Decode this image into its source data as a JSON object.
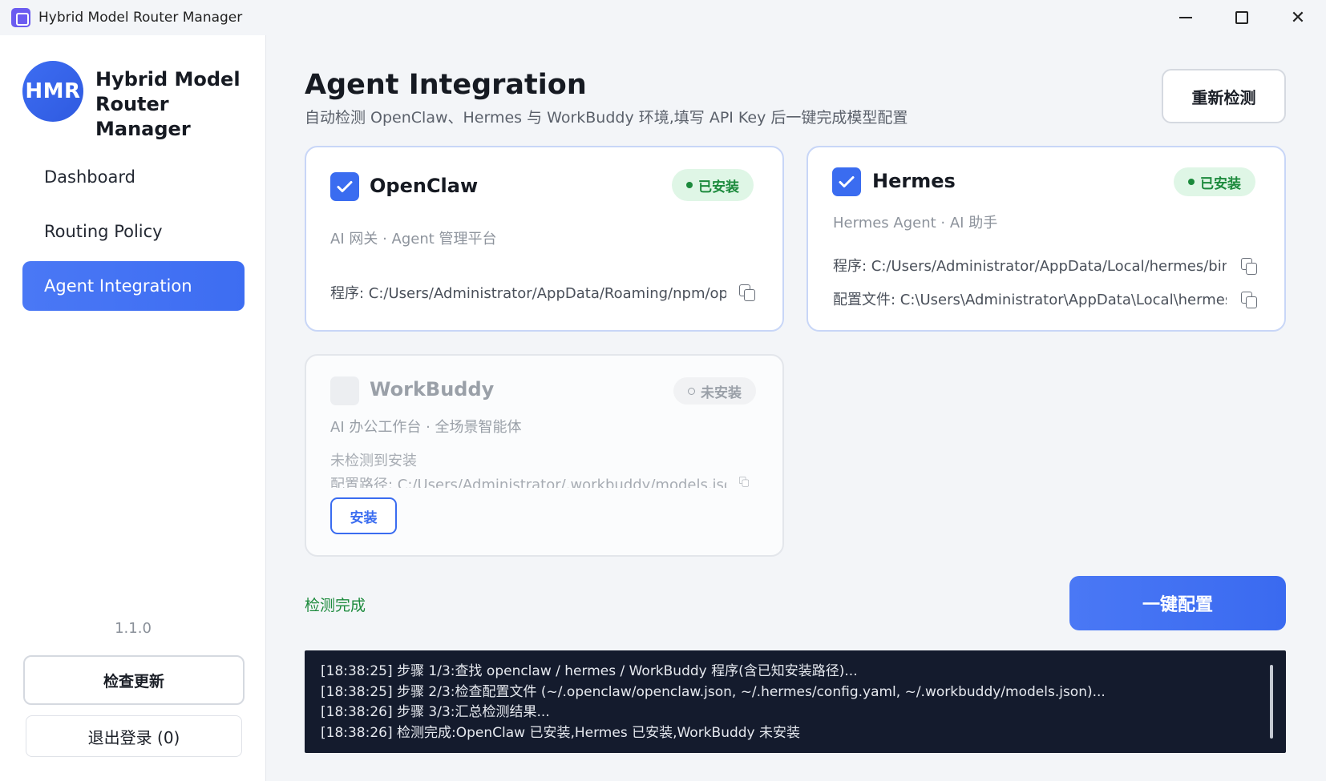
{
  "window": {
    "title": "Hybrid Model Router Manager"
  },
  "sidebar": {
    "logo_text": "HMR",
    "brand_line1": "Hybrid Model",
    "brand_line2": "Router Manager",
    "items": [
      {
        "label": "Dashboard"
      },
      {
        "label": "Routing Policy"
      },
      {
        "label": "Agent Integration"
      }
    ],
    "version": "1.1.0",
    "check_update": "检查更新",
    "logout": "退出登录 (0)"
  },
  "header": {
    "title": "Agent Integration",
    "subtitle": "自动检测 OpenClaw、Hermes 与 WorkBuddy 环境,填写 API Key 后一键完成模型配置",
    "recheck": "重新检测"
  },
  "cards": {
    "openclaw": {
      "name": "OpenClaw",
      "status": "已安装",
      "desc": "AI 网关 · Agent 管理平台",
      "program": "程序: C:/Users/Administrator/AppData/Roaming/npm/openclaw.cmd"
    },
    "hermes": {
      "name": "Hermes",
      "status": "已安装",
      "desc": "Hermes Agent · AI 助手",
      "program": "程序: C:/Users/Administrator/AppData/Local/hermes/bin/hermes.exe",
      "config": "配置文件: C:\\Users\\Administrator\\AppData\\Local\\hermes\\config.yaml"
    },
    "workbuddy": {
      "name": "WorkBuddy",
      "status": "未安装",
      "desc": "AI 办公工作台 · 全场景智能体",
      "not_found": "未检测到安装",
      "config_path": "配置路径: C:/Users/Administrator/.workbuddy/models.json",
      "install": "安装"
    }
  },
  "footer": {
    "status": "检测完成",
    "one_click": "一键配置"
  },
  "log": [
    "[18:38:25] 步骤 1/3:查找 openclaw / hermes / WorkBuddy 程序(含已知安装路径)...",
    "[18:38:25] 步骤 2/3:检查配置文件 (~/.openclaw/openclaw.json, ~/.hermes/config.yaml, ~/.workbuddy/models.json)...",
    "[18:38:26] 步骤 3/3:汇总检测结果...",
    "[18:38:26] 检测完成:OpenClaw 已安装,Hermes 已安装,WorkBuddy 未安装"
  ],
  "colors": {
    "accent": "#3a6cf0",
    "success": "#1c8a3c",
    "log_bg": "#141b2d"
  }
}
